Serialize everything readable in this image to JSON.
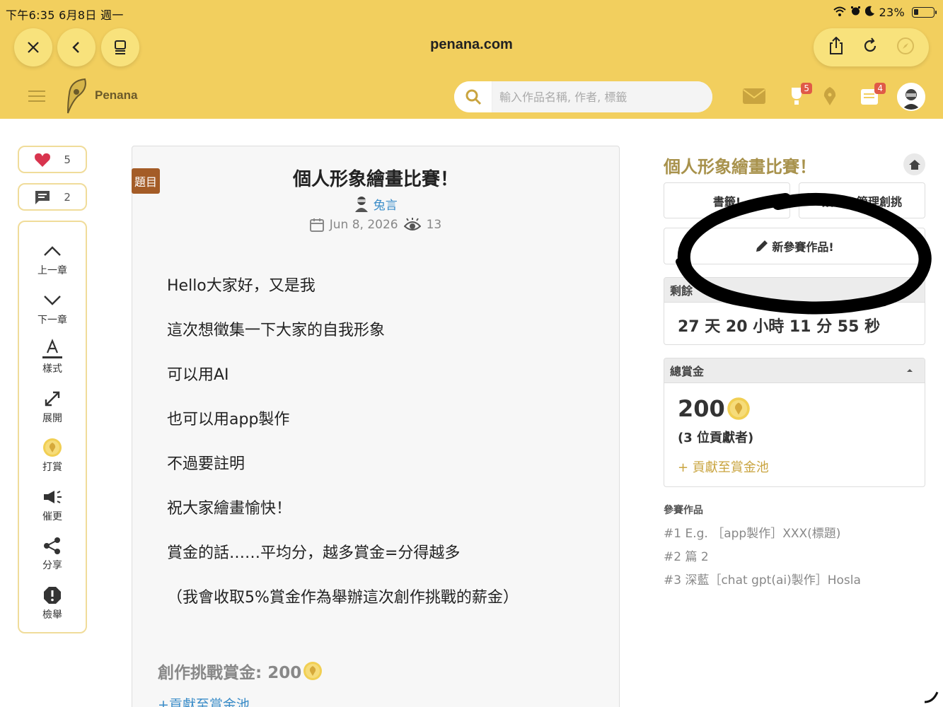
{
  "status_bar": {
    "time_date": "下午6:35   6月8日 週一",
    "battery": "23%"
  },
  "browser": {
    "url": "penana.com",
    "buttons": [
      "close-icon",
      "back-icon",
      "tabs-icon",
      "share-icon",
      "reload-icon",
      "compass-icon"
    ]
  },
  "nav": {
    "logo_text": "Penana",
    "search_placeholder": "輸入作品名稱, 作者, 標籤",
    "badges": {
      "rewards": "5",
      "notifications": "4"
    },
    "accent": "#f2cf5e"
  },
  "sidebar": {
    "likes": "5",
    "comments": "2",
    "tools": [
      {
        "icon": "chevron-up-icon",
        "label": "上一章"
      },
      {
        "icon": "chevron-down-icon",
        "label": "下一章"
      },
      {
        "icon": "font-style-icon",
        "label": "樣式"
      },
      {
        "icon": "expand-icon",
        "label": "展開"
      },
      {
        "icon": "coin-icon",
        "label": "打賞"
      },
      {
        "icon": "megaphone-icon",
        "label": "催更"
      },
      {
        "icon": "share-icon",
        "label": "分享"
      },
      {
        "icon": "report-icon",
        "label": "檢舉"
      }
    ]
  },
  "article": {
    "tag": "題目",
    "title": "個人形象繪畫比賽！",
    "author": "兔言",
    "date": "Jun 8, 2026",
    "views": "13",
    "paragraphs": [
      "Hello大家好，又是我",
      "這次想徵集一下大家的自我形象",
      "可以用AI",
      "也可以用app製作",
      "不過要註明",
      "祝大家繪畫愉快！",
      "賞金的話……平均分，越多賞金=分得越多",
      "（我會收取5%賞金作為舉辦這次創作挑戰的薪金）"
    ],
    "prize_label": "創作挑戰賞金: 200",
    "contribute_link": "+貢獻至賞金池"
  },
  "right_panel": {
    "title": "個人形象繪畫比賽！",
    "bookmark_btn": "書籤!",
    "manage_btn": "簽籤 / 管理創挑",
    "new_entry_btn": "新參賽作品!",
    "remaining_header": "剩餘",
    "remaining_value": "27 天 20 小時 11 分 55 秒",
    "bounty_header": "總賞金",
    "bounty_amount": "200",
    "bounty_contributors": "(3 位貢獻者)",
    "bounty_add": "+ 貢獻至賞金池",
    "entries_header": "參賽作品",
    "entries": [
      "#1 E.g. ［app製作］XXX(標題)",
      "#2 篇 2",
      "#3 深藍［chat gpt(ai)製作］Hosla"
    ]
  }
}
